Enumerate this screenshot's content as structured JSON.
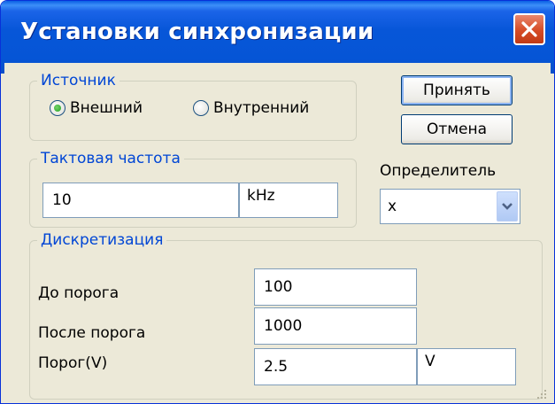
{
  "window": {
    "title": "Установки синхронизации"
  },
  "source_group": {
    "legend": "Источник",
    "options": [
      {
        "label": "Внешний",
        "checked": true
      },
      {
        "label": "Внутренний",
        "checked": false
      }
    ]
  },
  "clock_group": {
    "legend": "Тактовая частота",
    "value": "10",
    "unit": "kHz"
  },
  "buttons": {
    "accept": "Принять",
    "cancel": "Отмена"
  },
  "qualifier": {
    "label": "Определитель",
    "selected": "x"
  },
  "sampling_group": {
    "legend": "Дискретизация",
    "before_label": "До порога",
    "before_value": "100",
    "after_label": "После порога",
    "after_value": "1000",
    "threshold_label": "Порог(V)",
    "threshold_value": "2.5",
    "threshold_unit": "V"
  },
  "colors": {
    "title_bar": "#0555d6",
    "close_button": "#d64b26",
    "legend_text": "#0046d5",
    "dialog_bg": "#ece9d8"
  },
  "icons": {
    "close": "close-icon",
    "dropdown": "chevron-down-icon",
    "radio_checked": "radio-checked-icon"
  }
}
